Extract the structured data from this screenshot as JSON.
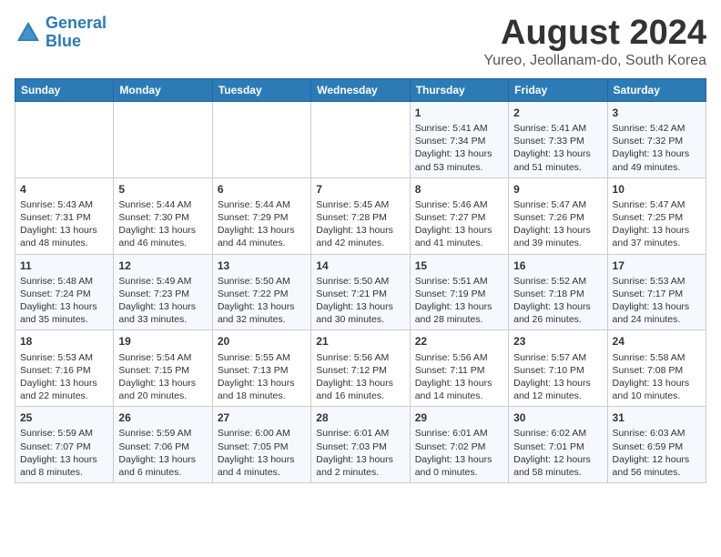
{
  "header": {
    "logo_line1": "General",
    "logo_line2": "Blue",
    "main_title": "August 2024",
    "subtitle": "Yureo, Jeollanam-do, South Korea"
  },
  "weekdays": [
    "Sunday",
    "Monday",
    "Tuesday",
    "Wednesday",
    "Thursday",
    "Friday",
    "Saturday"
  ],
  "weeks": [
    [
      {
        "day": "",
        "content": ""
      },
      {
        "day": "",
        "content": ""
      },
      {
        "day": "",
        "content": ""
      },
      {
        "day": "",
        "content": ""
      },
      {
        "day": "1",
        "content": "Sunrise: 5:41 AM\nSunset: 7:34 PM\nDaylight: 13 hours\nand 53 minutes."
      },
      {
        "day": "2",
        "content": "Sunrise: 5:41 AM\nSunset: 7:33 PM\nDaylight: 13 hours\nand 51 minutes."
      },
      {
        "day": "3",
        "content": "Sunrise: 5:42 AM\nSunset: 7:32 PM\nDaylight: 13 hours\nand 49 minutes."
      }
    ],
    [
      {
        "day": "4",
        "content": "Sunrise: 5:43 AM\nSunset: 7:31 PM\nDaylight: 13 hours\nand 48 minutes."
      },
      {
        "day": "5",
        "content": "Sunrise: 5:44 AM\nSunset: 7:30 PM\nDaylight: 13 hours\nand 46 minutes."
      },
      {
        "day": "6",
        "content": "Sunrise: 5:44 AM\nSunset: 7:29 PM\nDaylight: 13 hours\nand 44 minutes."
      },
      {
        "day": "7",
        "content": "Sunrise: 5:45 AM\nSunset: 7:28 PM\nDaylight: 13 hours\nand 42 minutes."
      },
      {
        "day": "8",
        "content": "Sunrise: 5:46 AM\nSunset: 7:27 PM\nDaylight: 13 hours\nand 41 minutes."
      },
      {
        "day": "9",
        "content": "Sunrise: 5:47 AM\nSunset: 7:26 PM\nDaylight: 13 hours\nand 39 minutes."
      },
      {
        "day": "10",
        "content": "Sunrise: 5:47 AM\nSunset: 7:25 PM\nDaylight: 13 hours\nand 37 minutes."
      }
    ],
    [
      {
        "day": "11",
        "content": "Sunrise: 5:48 AM\nSunset: 7:24 PM\nDaylight: 13 hours\nand 35 minutes."
      },
      {
        "day": "12",
        "content": "Sunrise: 5:49 AM\nSunset: 7:23 PM\nDaylight: 13 hours\nand 33 minutes."
      },
      {
        "day": "13",
        "content": "Sunrise: 5:50 AM\nSunset: 7:22 PM\nDaylight: 13 hours\nand 32 minutes."
      },
      {
        "day": "14",
        "content": "Sunrise: 5:50 AM\nSunset: 7:21 PM\nDaylight: 13 hours\nand 30 minutes."
      },
      {
        "day": "15",
        "content": "Sunrise: 5:51 AM\nSunset: 7:19 PM\nDaylight: 13 hours\nand 28 minutes."
      },
      {
        "day": "16",
        "content": "Sunrise: 5:52 AM\nSunset: 7:18 PM\nDaylight: 13 hours\nand 26 minutes."
      },
      {
        "day": "17",
        "content": "Sunrise: 5:53 AM\nSunset: 7:17 PM\nDaylight: 13 hours\nand 24 minutes."
      }
    ],
    [
      {
        "day": "18",
        "content": "Sunrise: 5:53 AM\nSunset: 7:16 PM\nDaylight: 13 hours\nand 22 minutes."
      },
      {
        "day": "19",
        "content": "Sunrise: 5:54 AM\nSunset: 7:15 PM\nDaylight: 13 hours\nand 20 minutes."
      },
      {
        "day": "20",
        "content": "Sunrise: 5:55 AM\nSunset: 7:13 PM\nDaylight: 13 hours\nand 18 minutes."
      },
      {
        "day": "21",
        "content": "Sunrise: 5:56 AM\nSunset: 7:12 PM\nDaylight: 13 hours\nand 16 minutes."
      },
      {
        "day": "22",
        "content": "Sunrise: 5:56 AM\nSunset: 7:11 PM\nDaylight: 13 hours\nand 14 minutes."
      },
      {
        "day": "23",
        "content": "Sunrise: 5:57 AM\nSunset: 7:10 PM\nDaylight: 13 hours\nand 12 minutes."
      },
      {
        "day": "24",
        "content": "Sunrise: 5:58 AM\nSunset: 7:08 PM\nDaylight: 13 hours\nand 10 minutes."
      }
    ],
    [
      {
        "day": "25",
        "content": "Sunrise: 5:59 AM\nSunset: 7:07 PM\nDaylight: 13 hours\nand 8 minutes."
      },
      {
        "day": "26",
        "content": "Sunrise: 5:59 AM\nSunset: 7:06 PM\nDaylight: 13 hours\nand 6 minutes."
      },
      {
        "day": "27",
        "content": "Sunrise: 6:00 AM\nSunset: 7:05 PM\nDaylight: 13 hours\nand 4 minutes."
      },
      {
        "day": "28",
        "content": "Sunrise: 6:01 AM\nSunset: 7:03 PM\nDaylight: 13 hours\nand 2 minutes."
      },
      {
        "day": "29",
        "content": "Sunrise: 6:01 AM\nSunset: 7:02 PM\nDaylight: 13 hours\nand 0 minutes."
      },
      {
        "day": "30",
        "content": "Sunrise: 6:02 AM\nSunset: 7:01 PM\nDaylight: 12 hours\nand 58 minutes."
      },
      {
        "day": "31",
        "content": "Sunrise: 6:03 AM\nSunset: 6:59 PM\nDaylight: 12 hours\nand 56 minutes."
      }
    ]
  ]
}
